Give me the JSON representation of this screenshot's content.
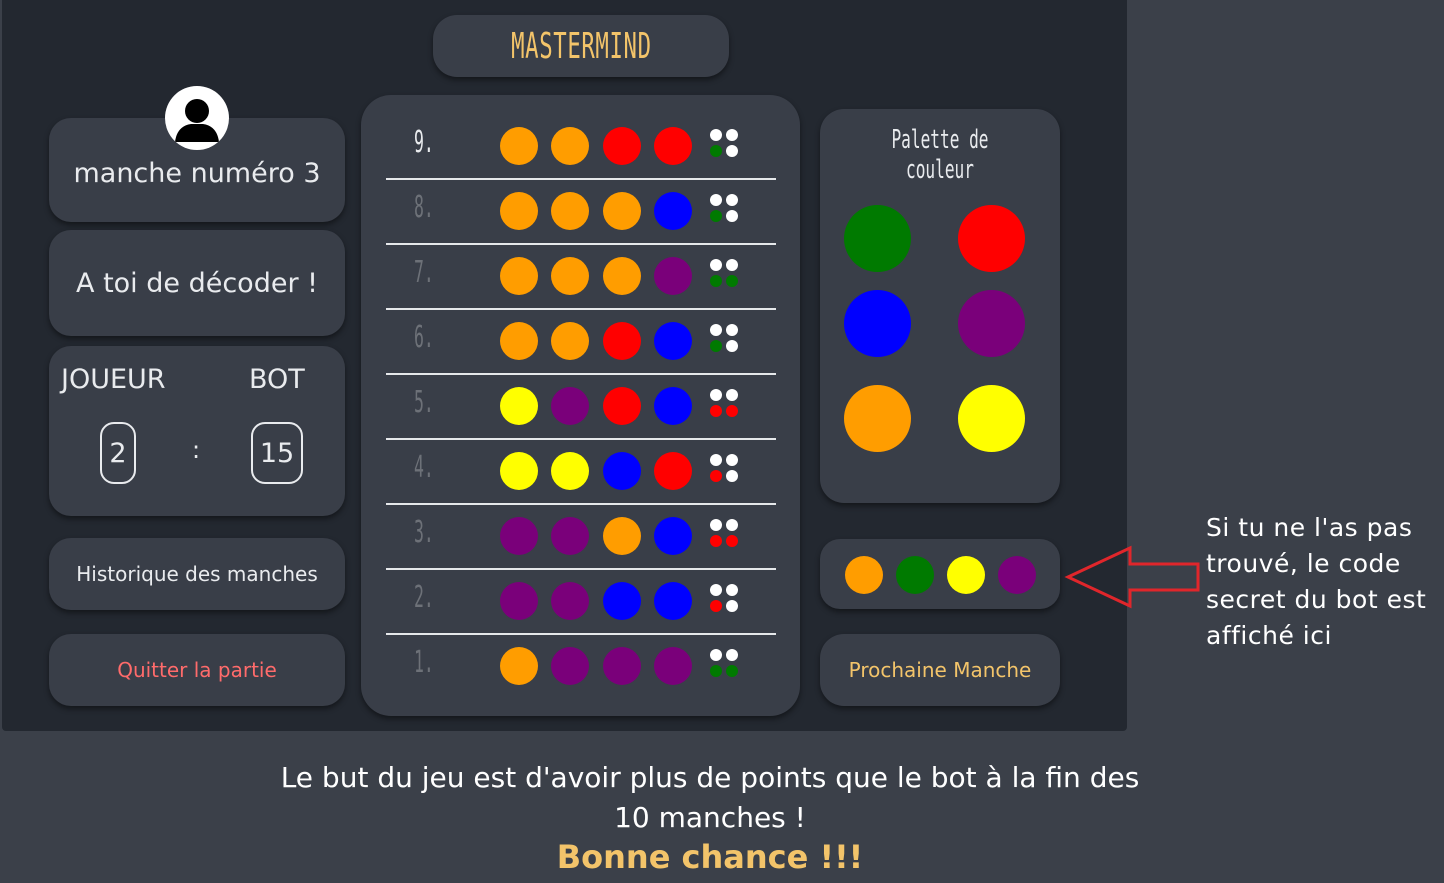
{
  "title": "MASTERMIND",
  "round_label": "manche numéro 3",
  "turn_label": "A toi de décoder !",
  "score": {
    "player_label": "JOUEUR",
    "bot_label": "BOT",
    "player_value": "2",
    "bot_value": "15",
    "separator": ":"
  },
  "history_button": "Historique des manches",
  "quit_button": "Quitter la partie",
  "palette_title": "Palette de couleur",
  "next_button": "Prochaine Manche",
  "colors": {
    "orange": "#ff9d00",
    "red": "#ff0000",
    "blue": "#0000ff",
    "purple": "#7a007a",
    "yellow": "#ffff00",
    "green": "#007a00",
    "white": "#ffffff"
  },
  "palette": [
    "green",
    "red",
    "blue",
    "purple",
    "orange",
    "yellow"
  ],
  "rows": [
    {
      "num": "9.",
      "active": true,
      "pegs": [
        "orange",
        "orange",
        "red",
        "red"
      ],
      "feedback": [
        "white",
        "white",
        "green",
        "white"
      ]
    },
    {
      "num": "8.",
      "active": false,
      "pegs": [
        "orange",
        "orange",
        "orange",
        "blue"
      ],
      "feedback": [
        "white",
        "white",
        "green",
        "white"
      ]
    },
    {
      "num": "7.",
      "active": false,
      "pegs": [
        "orange",
        "orange",
        "orange",
        "purple"
      ],
      "feedback": [
        "white",
        "white",
        "green",
        "green"
      ]
    },
    {
      "num": "6.",
      "active": false,
      "pegs": [
        "orange",
        "orange",
        "red",
        "blue"
      ],
      "feedback": [
        "white",
        "white",
        "green",
        "white"
      ]
    },
    {
      "num": "5.",
      "active": false,
      "pegs": [
        "yellow",
        "purple",
        "red",
        "blue"
      ],
      "feedback": [
        "white",
        "white",
        "red",
        "red"
      ]
    },
    {
      "num": "4.",
      "active": false,
      "pegs": [
        "yellow",
        "yellow",
        "blue",
        "red"
      ],
      "feedback": [
        "white",
        "white",
        "red",
        "white"
      ]
    },
    {
      "num": "3.",
      "active": false,
      "pegs": [
        "purple",
        "purple",
        "orange",
        "blue"
      ],
      "feedback": [
        "white",
        "white",
        "red",
        "red"
      ]
    },
    {
      "num": "2.",
      "active": false,
      "pegs": [
        "purple",
        "purple",
        "blue",
        "blue"
      ],
      "feedback": [
        "white",
        "white",
        "red",
        "white"
      ]
    },
    {
      "num": "1.",
      "active": false,
      "pegs": [
        "orange",
        "purple",
        "purple",
        "purple"
      ],
      "feedback": [
        "white",
        "white",
        "green",
        "green"
      ]
    }
  ],
  "secret_code": [
    "orange",
    "green",
    "yellow",
    "purple"
  ],
  "annotation": "Si tu ne l'as pas trouvé, le code secret du bot est affiché ici",
  "footer_line1": "Le but du jeu est d'avoir plus de points que le bot à la fin des",
  "footer_line2": "10 manches !",
  "footer_good_luck": "Bonne chance !!!",
  "icons": {
    "avatar": "user-silhouette-icon",
    "arrow": "left-arrow-outline-icon"
  }
}
